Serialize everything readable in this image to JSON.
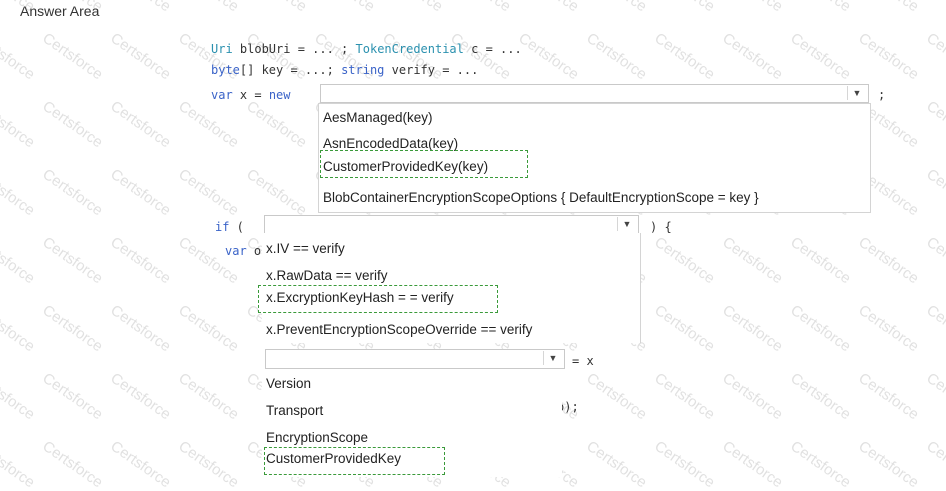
{
  "answer_area_title": "Answer Area",
  "watermark_text": "Certsforce",
  "accent_dashed_color": "#3a9a3a",
  "code": {
    "line1": {
      "t1": "Uri",
      "t2": " blobUri = ... ; ",
      "t3": "TokenCredential",
      "t4": " c = ..."
    },
    "line2": {
      "t1": "byte",
      "t2": "[] key = ...; ",
      "t3": "string",
      "t4": " verify = ..."
    },
    "line3": {
      "t1": "var",
      "t2": " x = ",
      "t3": "new"
    },
    "semicolon": ";",
    "if_kw": "if",
    "if_open": " (",
    "if_close": ") {",
    "var_o_kw": "var",
    "var_o_rest": " o",
    "eq_x": "= x",
    "tail": "o);"
  },
  "dropdown1": {
    "options": [
      "AesManaged(key)",
      "AsnEncodedData(key)",
      "CustomerProvidedKey(key)",
      "BlobContainerEncryptionScopeOptions { DefaultEncryptionScope = key }"
    ]
  },
  "dropdown2": {
    "options": [
      "x.IV == verify",
      "x.RawData == verify",
      "x.ExcryptionKeyHash = = verify",
      "x.PreventEncryptionScopeOverride == verify"
    ]
  },
  "dropdown3": {
    "options": [
      "Version",
      "Transport",
      "EncryptionScope",
      "CustomerProvidedKey"
    ]
  }
}
